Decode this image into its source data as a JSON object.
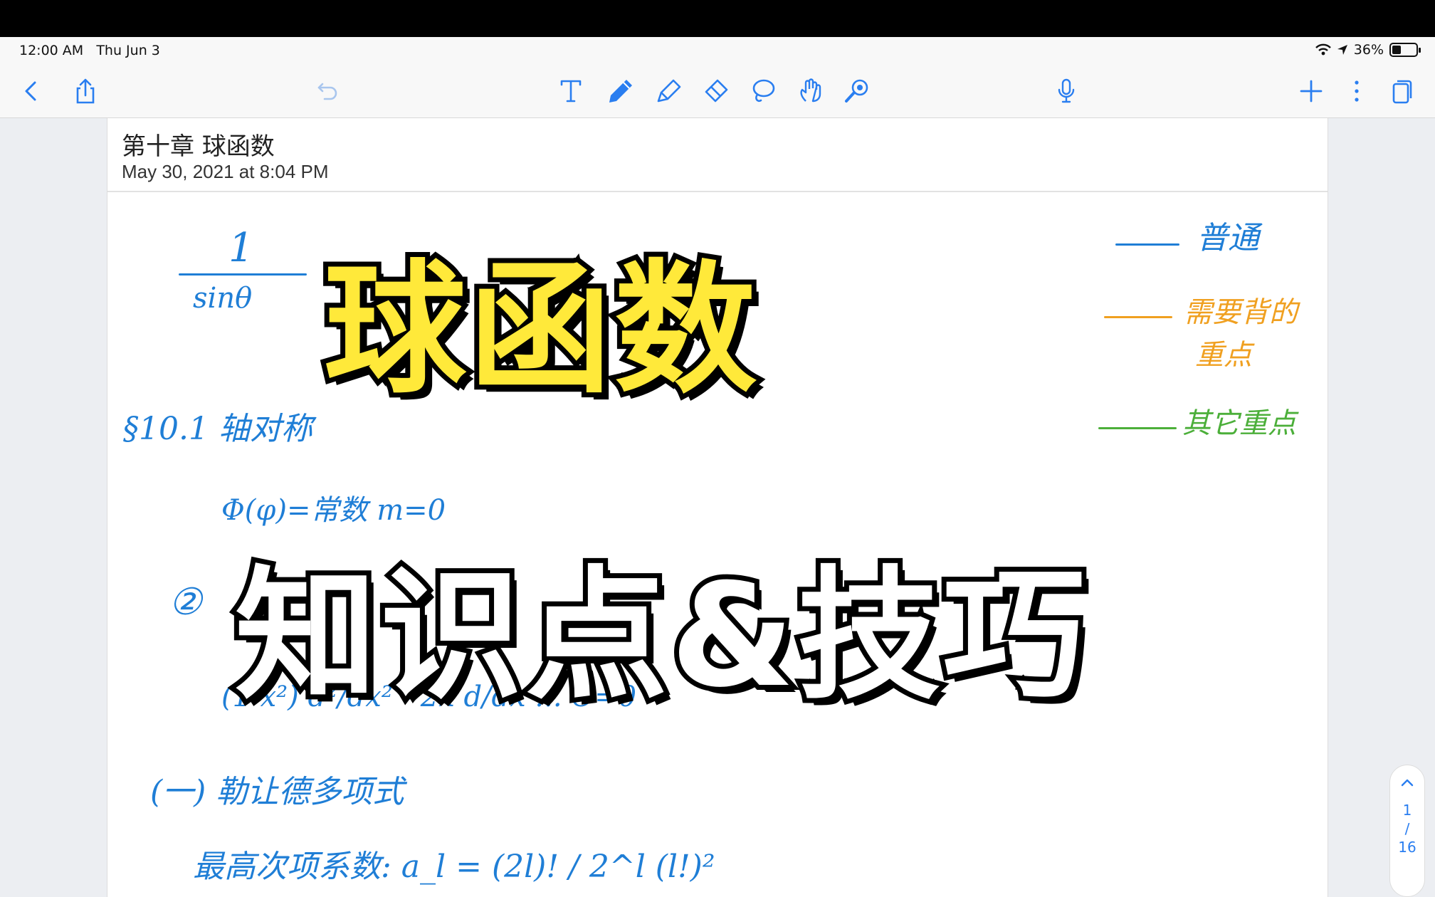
{
  "status_bar": {
    "time": "12:00 AM",
    "date": "Thu Jun 3",
    "battery": "36%",
    "icons": [
      "wifi-icon",
      "location-icon",
      "battery-icon"
    ]
  },
  "toolbar": {
    "left": [
      "back-chevron-icon",
      "share-icon",
      "undo-icon"
    ],
    "tools": [
      "text-tool-icon",
      "pen-tool-icon",
      "highlighter-tool-icon",
      "eraser-tool-icon",
      "lasso-tool-icon",
      "hand-tool-icon",
      "laser-pointer-icon"
    ],
    "right": [
      "microphone-icon",
      "add-icon",
      "more-icon",
      "pages-icon"
    ],
    "accent": "#1f7ed6"
  },
  "note": {
    "title": "第十章 球函数",
    "date": "May 30, 2021 at 8:04 PM"
  },
  "handwriting": {
    "fraction_top": "1",
    "fraction_bottom": "sinθ",
    "section": "§10.1 轴对称",
    "line2": "Φ(φ)=常数  m=0",
    "circled": "②",
    "equation": "(1-x²) d²/dx² - 2x d/dx ... Θ=0",
    "subsection": "(一) 勒让德多项式",
    "coeff": "最高次项系数:  a_l = (2l)! / 2^l (l!)²"
  },
  "legend": {
    "normal": "普通",
    "must_remember": "需要背的",
    "must_remember_2": "重点",
    "other_key": "其它重点",
    "colors": {
      "normal": "#1f7ed6",
      "must_remember": "#f0a020",
      "other_key": "#4caf3a"
    }
  },
  "overlay": {
    "title": "球函数",
    "subtitle": "知识点&技巧",
    "title_color": "#ffe93a",
    "subtitle_color": "#ffffff"
  },
  "page_indicator": {
    "current": "1",
    "separator": "/",
    "total": "16"
  }
}
